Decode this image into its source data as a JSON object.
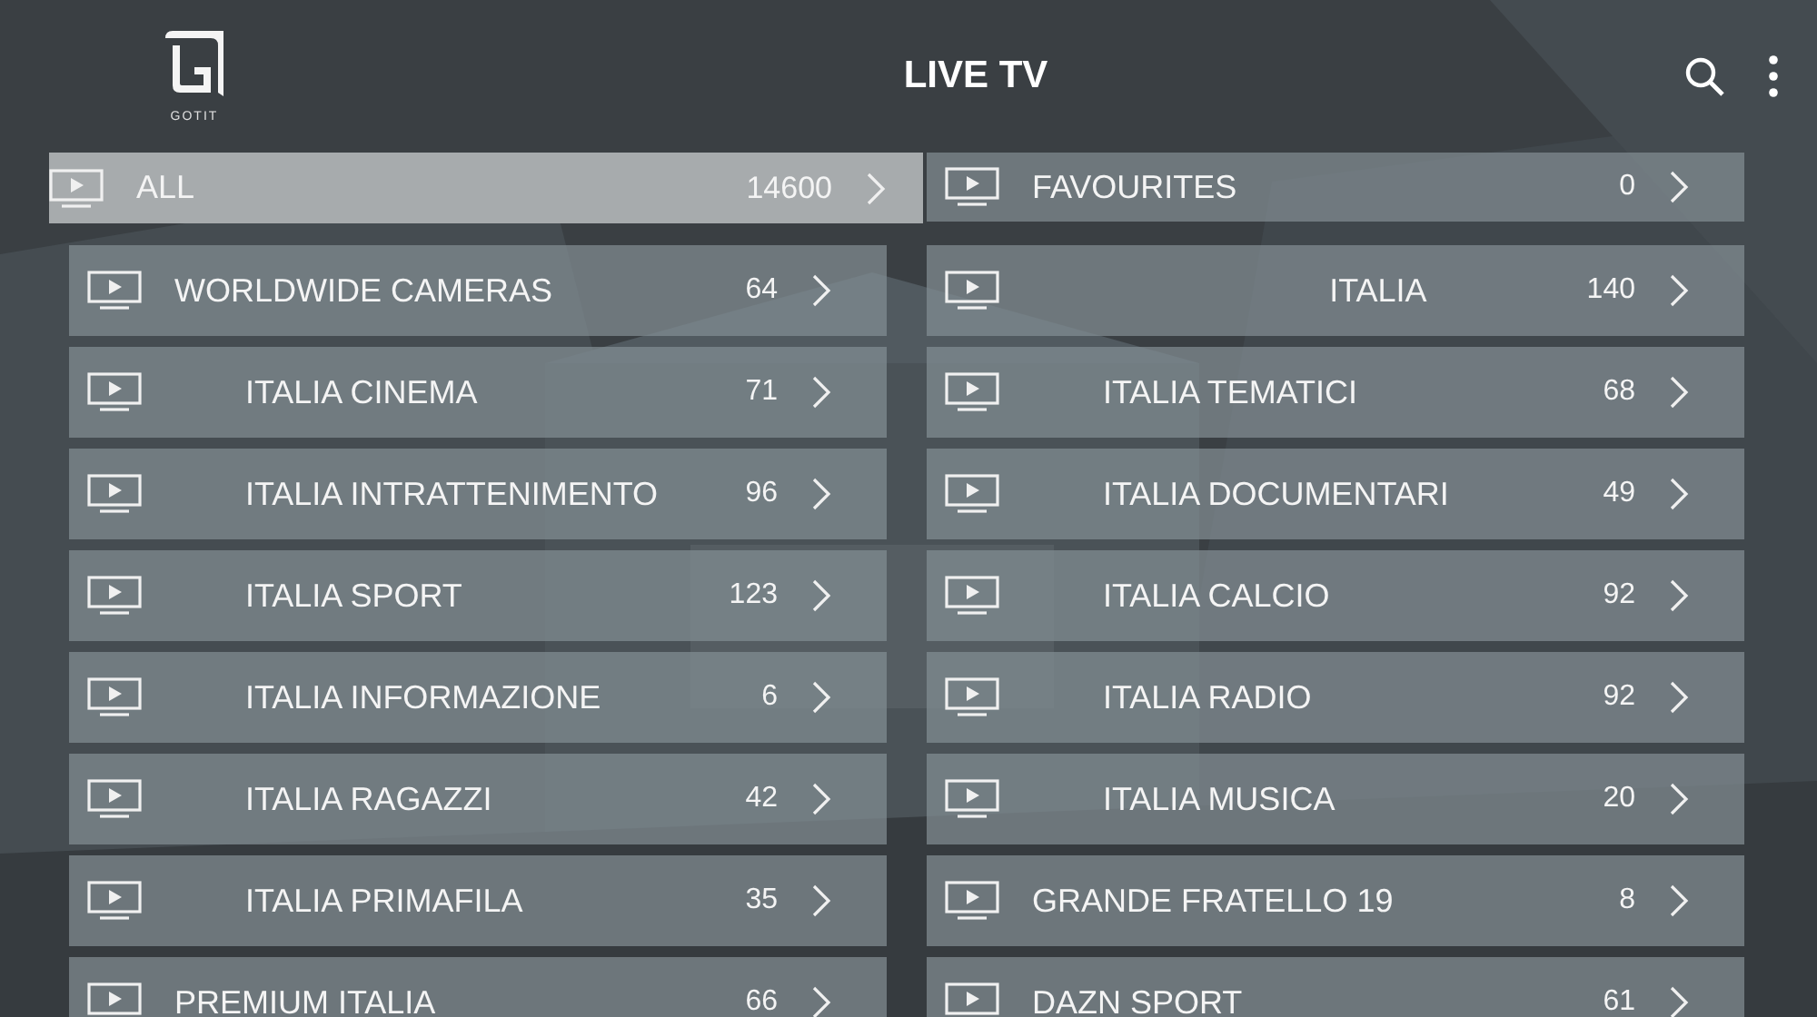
{
  "header": {
    "logo_text": "GOTIT",
    "title": "LIVE TV"
  },
  "categories": [
    {
      "name": "ALL",
      "count": "14600",
      "selected": true,
      "kind": "plain"
    },
    {
      "name": "FAVOURITES",
      "count": "0",
      "selected": false,
      "kind": "plain"
    },
    {
      "name": "WORLDWIDE CAMERAS",
      "count": "64",
      "selected": false,
      "kind": "plain"
    },
    {
      "name": "ITALIA",
      "count": "140",
      "selected": false,
      "kind": "centered"
    },
    {
      "name": "ITALIA CINEMA",
      "count": "71",
      "selected": false,
      "kind": "indented"
    },
    {
      "name": "ITALIA TEMATICI",
      "count": "68",
      "selected": false,
      "kind": "indented"
    },
    {
      "name": "ITALIA INTRATTENIMENTO",
      "count": "96",
      "selected": false,
      "kind": "indented"
    },
    {
      "name": "ITALIA DOCUMENTARI",
      "count": "49",
      "selected": false,
      "kind": "indented"
    },
    {
      "name": "ITALIA SPORT",
      "count": "123",
      "selected": false,
      "kind": "indented"
    },
    {
      "name": "ITALIA CALCIO",
      "count": "92",
      "selected": false,
      "kind": "indented"
    },
    {
      "name": "ITALIA INFORMAZIONE",
      "count": "6",
      "selected": false,
      "kind": "indented"
    },
    {
      "name": "ITALIA RADIO",
      "count": "92",
      "selected": false,
      "kind": "indented"
    },
    {
      "name": "ITALIA RAGAZZI",
      "count": "42",
      "selected": false,
      "kind": "indented"
    },
    {
      "name": "ITALIA MUSICA",
      "count": "20",
      "selected": false,
      "kind": "indented"
    },
    {
      "name": "ITALIA PRIMAFILA",
      "count": "35",
      "selected": false,
      "kind": "indented"
    },
    {
      "name": "GRANDE FRATELLO 19",
      "count": "8",
      "selected": false,
      "kind": "plain"
    },
    {
      "name": "PREMIUM ITALIA",
      "count": "66",
      "selected": false,
      "kind": "plain"
    },
    {
      "name": "DAZN SPORT",
      "count": "61",
      "selected": false,
      "kind": "plain"
    }
  ]
}
